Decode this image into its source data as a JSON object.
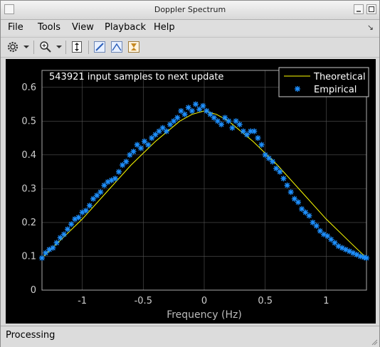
{
  "window": {
    "title": "Doppler Spectrum"
  },
  "menu": [
    "File",
    "Tools",
    "View",
    "Playback",
    "Help"
  ],
  "toolbar": {
    "icons": [
      "gear-icon",
      "dropdown-arrow-icon",
      "zoom-in-icon",
      "dropdown-arrow-icon",
      "fit-to-view-icon",
      "highlight-icon",
      "peak-finder-icon",
      "measurement-icon"
    ]
  },
  "status": "Processing",
  "colors": {
    "background": "#000000",
    "axes": "#ffffff",
    "theoretical": "#ffff00",
    "empirical": "#1e90ff",
    "grid": "#555555"
  },
  "chart_data": {
    "type": "line",
    "annotation": "543921 input samples to next update",
    "xlabel": "Frequency (Hz)",
    "ylabel": "",
    "xlim": [
      -1.33,
      1.33
    ],
    "ylim": [
      0,
      0.65
    ],
    "xticks": [
      -1,
      -0.5,
      0,
      0.5,
      1
    ],
    "xtick_labels": [
      "-1",
      "-0.5",
      "0",
      "0.5",
      "1"
    ],
    "yticks": [
      0,
      0.1,
      0.2,
      0.3,
      0.4,
      0.5,
      0.6
    ],
    "ytick_labels": [
      "0",
      "0.1",
      "0.2",
      "0.3",
      "0.4",
      "0.5",
      "0.6"
    ],
    "grid": true,
    "legend_position": "top-right",
    "series": [
      {
        "name": "Theoretical",
        "style": "line",
        "x": [
          -1.33,
          -1.2,
          -1.0,
          -0.8,
          -0.6,
          -0.4,
          -0.2,
          -0.1,
          0.0,
          0.1,
          0.2,
          0.4,
          0.6,
          0.8,
          1.0,
          1.2,
          1.33
        ],
        "y": [
          0.095,
          0.14,
          0.21,
          0.29,
          0.37,
          0.44,
          0.5,
          0.52,
          0.53,
          0.52,
          0.5,
          0.44,
          0.37,
          0.29,
          0.21,
          0.14,
          0.095
        ]
      },
      {
        "name": "Empirical",
        "style": "marker",
        "x": [
          -1.33,
          -1.3,
          -1.27,
          -1.24,
          -1.21,
          -1.18,
          -1.15,
          -1.12,
          -1.09,
          -1.06,
          -1.03,
          -1.0,
          -0.97,
          -0.94,
          -0.91,
          -0.88,
          -0.85,
          -0.82,
          -0.79,
          -0.76,
          -0.73,
          -0.7,
          -0.67,
          -0.64,
          -0.61,
          -0.58,
          -0.55,
          -0.52,
          -0.49,
          -0.46,
          -0.43,
          -0.4,
          -0.37,
          -0.34,
          -0.31,
          -0.28,
          -0.25,
          -0.22,
          -0.19,
          -0.16,
          -0.13,
          -0.1,
          -0.07,
          -0.04,
          -0.01,
          0.02,
          0.05,
          0.08,
          0.11,
          0.14,
          0.17,
          0.2,
          0.23,
          0.26,
          0.29,
          0.32,
          0.35,
          0.38,
          0.41,
          0.44,
          0.47,
          0.5,
          0.53,
          0.56,
          0.59,
          0.62,
          0.65,
          0.68,
          0.71,
          0.74,
          0.77,
          0.8,
          0.83,
          0.86,
          0.89,
          0.92,
          0.95,
          0.98,
          1.01,
          1.04,
          1.07,
          1.1,
          1.13,
          1.16,
          1.19,
          1.22,
          1.25,
          1.28,
          1.31,
          1.33
        ],
        "y": [
          0.095,
          0.11,
          0.12,
          0.125,
          0.14,
          0.155,
          0.165,
          0.18,
          0.195,
          0.21,
          0.215,
          0.23,
          0.235,
          0.25,
          0.27,
          0.28,
          0.29,
          0.31,
          0.32,
          0.325,
          0.33,
          0.35,
          0.37,
          0.38,
          0.4,
          0.41,
          0.43,
          0.42,
          0.44,
          0.43,
          0.45,
          0.46,
          0.47,
          0.48,
          0.47,
          0.49,
          0.5,
          0.51,
          0.53,
          0.52,
          0.54,
          0.53,
          0.55,
          0.535,
          0.545,
          0.53,
          0.52,
          0.51,
          0.5,
          0.49,
          0.51,
          0.5,
          0.48,
          0.5,
          0.49,
          0.47,
          0.46,
          0.47,
          0.47,
          0.45,
          0.43,
          0.4,
          0.39,
          0.38,
          0.36,
          0.35,
          0.33,
          0.31,
          0.29,
          0.27,
          0.26,
          0.24,
          0.23,
          0.22,
          0.2,
          0.19,
          0.175,
          0.165,
          0.16,
          0.15,
          0.14,
          0.13,
          0.125,
          0.12,
          0.115,
          0.11,
          0.105,
          0.1,
          0.097,
          0.095
        ]
      }
    ]
  }
}
